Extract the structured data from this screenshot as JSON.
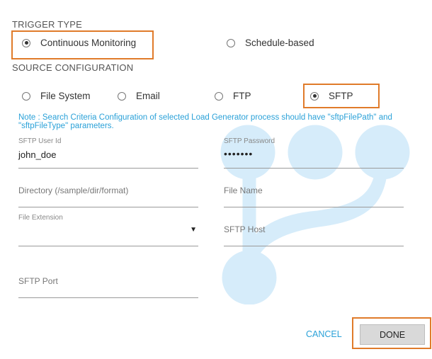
{
  "trigger_type": {
    "title": "TRIGGER TYPE",
    "options": [
      {
        "label": "Continuous Monitoring",
        "selected": true
      },
      {
        "label": "Schedule-based",
        "selected": false
      }
    ]
  },
  "source_configuration": {
    "title": "SOURCE CONFIGURATION",
    "options": [
      {
        "label": "File System",
        "selected": false
      },
      {
        "label": "Email",
        "selected": false
      },
      {
        "label": "FTP",
        "selected": false
      },
      {
        "label": "SFTP",
        "selected": true
      }
    ]
  },
  "note": "Note : Search Criteria Configuration of selected Load Generator process should have \"sftpFilePath\" and \"sftpFileType\" parameters.",
  "fields": {
    "sftp_user_id": {
      "label": "SFTP User Id",
      "value": "john_doe"
    },
    "sftp_password": {
      "label": "SFTP Password",
      "value": "•••••••"
    },
    "directory": {
      "placeholder": "Directory (/sample/dir/format)"
    },
    "file_name": {
      "placeholder": "File Name"
    },
    "file_extension": {
      "label": "File Extension",
      "value": ""
    },
    "sftp_host": {
      "placeholder": "SFTP Host"
    },
    "sftp_port": {
      "placeholder": "SFTP Port"
    }
  },
  "buttons": {
    "cancel": "CANCEL",
    "done": "DONE"
  },
  "colors": {
    "accent": "#2aa1d8",
    "highlight": "#e07b2a",
    "watermark": "#d6ecfa"
  },
  "icons": {
    "dropdown": "triangle-down-icon",
    "watermark": "source-control-branch-icon"
  }
}
